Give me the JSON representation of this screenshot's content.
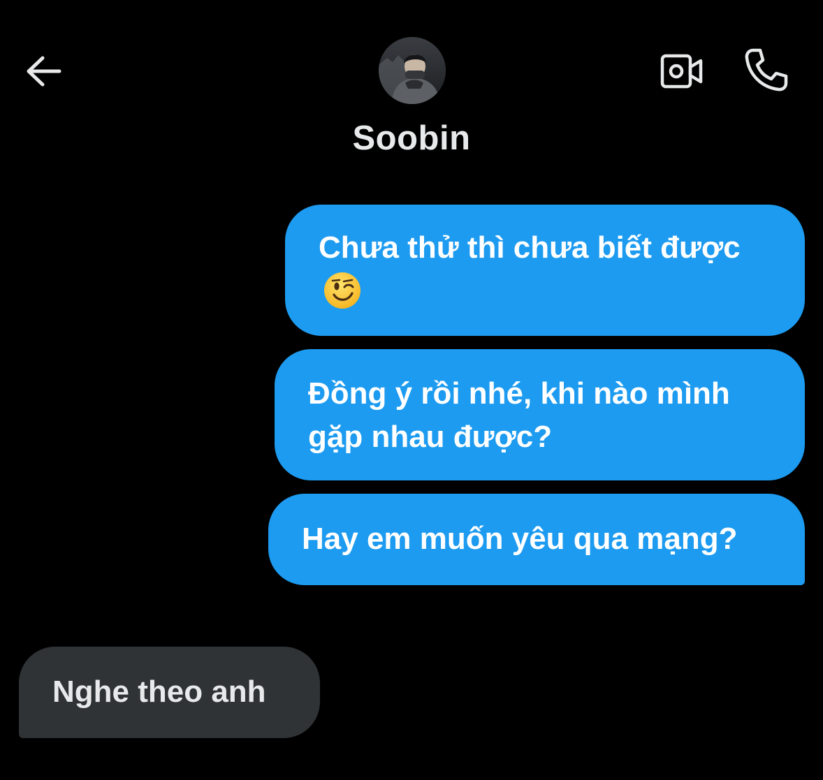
{
  "header": {
    "back_icon": "arrow-left-icon",
    "contact_name": "Soobin",
    "video_call_icon": "video-camera-icon",
    "voice_call_icon": "phone-icon"
  },
  "messages": [
    {
      "direction": "outgoing",
      "text": "Chưa thử thì chưa biết được",
      "emoji": "winking-face-emoji"
    },
    {
      "direction": "outgoing",
      "text": "Đồng ý rồi nhé, khi nào mình gặp nhau được?"
    },
    {
      "direction": "outgoing",
      "text": "Hay em muốn yêu qua mạng?"
    },
    {
      "direction": "incoming",
      "text": "Nghe theo anh"
    }
  ],
  "colors": {
    "background": "#000000",
    "outgoing_bubble": "#1d9bf0",
    "incoming_bubble": "#2f3336",
    "text": "#e7e9ea"
  }
}
